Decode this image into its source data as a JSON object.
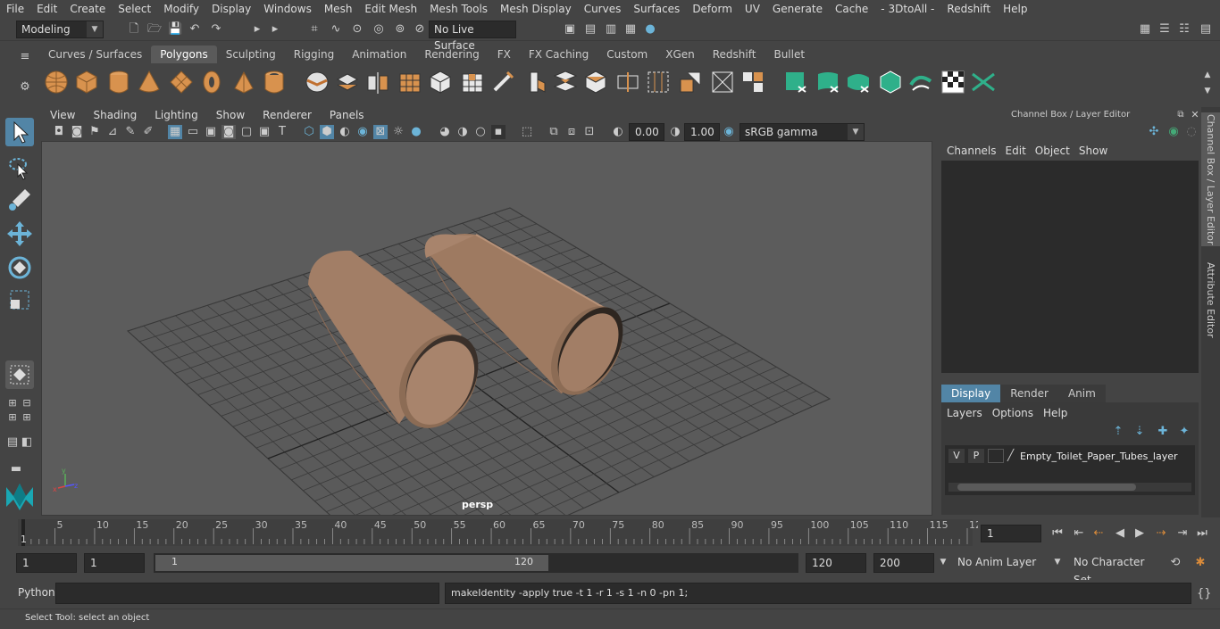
{
  "menu": [
    "File",
    "Edit",
    "Create",
    "Select",
    "Modify",
    "Display",
    "Windows",
    "Mesh",
    "Edit Mesh",
    "Mesh Tools",
    "Mesh Display",
    "Curves",
    "Surfaces",
    "Deform",
    "UV",
    "Generate",
    "Cache",
    "- 3DtoAll -",
    "Redshift",
    "Help"
  ],
  "status": {
    "mode": "Modeling",
    "live_surface": "No Live Surface"
  },
  "shelf_tabs": [
    "Curves / Surfaces",
    "Polygons",
    "Sculpting",
    "Rigging",
    "Animation",
    "Rendering",
    "FX",
    "FX Caching",
    "Custom",
    "XGen",
    "Redshift",
    "Bullet"
  ],
  "shelf_active": "Polygons",
  "viewport": {
    "menu": [
      "View",
      "Shading",
      "Lighting",
      "Show",
      "Renderer",
      "Panels"
    ],
    "exposure": "0.00",
    "gamma": "1.00",
    "color_space": "sRGB gamma",
    "camera": "persp"
  },
  "channelbox": {
    "title": "Channel Box / Layer Editor",
    "menu": [
      "Channels",
      "Edit",
      "Object",
      "Show"
    ],
    "tabs": [
      "Display",
      "Render",
      "Anim"
    ],
    "active_tab": "Display",
    "layer_menu": [
      "Layers",
      "Options",
      "Help"
    ],
    "layer": {
      "v": "V",
      "p": "P",
      "name": "Empty_Toilet_Paper_Tubes_layer"
    }
  },
  "side_tabs": [
    "Channel Box / Layer Editor",
    "Attribute Editor"
  ],
  "timeline": {
    "ticks": [
      "5",
      "10",
      "15",
      "20",
      "25",
      "30",
      "35",
      "40",
      "45",
      "50",
      "55",
      "60",
      "65",
      "70",
      "75",
      "80",
      "85",
      "90",
      "95",
      "100",
      "105",
      "110",
      "115",
      "12"
    ],
    "start_label": "1",
    "current_frame": "1"
  },
  "range": {
    "start": "1",
    "start2": "1",
    "slider_start": "1",
    "slider_end": "120",
    "end": "120",
    "end2": "200",
    "anim_layer": "No Anim Layer",
    "char_set": "No Character Set"
  },
  "cmd": {
    "label": "Python",
    "output": "makeIdentity -apply true -t 1 -r 1 -s 1 -n 0 -pn 1;"
  },
  "help": "Select Tool: select an object",
  "colors": {
    "accent": "#5285a6",
    "object": "#a27e66",
    "bg": "#444444",
    "viewport": "#5c5c5c"
  }
}
